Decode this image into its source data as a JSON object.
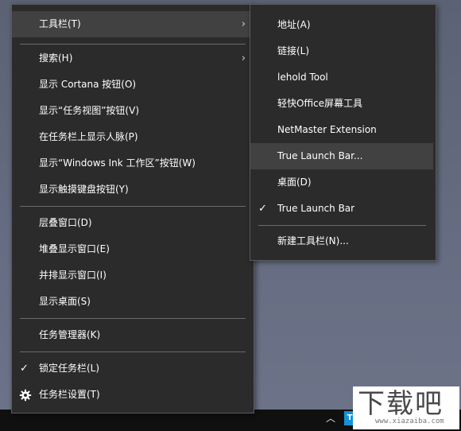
{
  "main_menu": {
    "toolbars": "工具栏(T)",
    "search": "搜索(H)",
    "show_cortana": "显示 Cortana 按钮(O)",
    "show_task_view": "显示“任务视图”按钮(V)",
    "show_people": "在任务栏上显示人脉(P)",
    "show_ink": "显示“Windows Ink 工作区”按钮(W)",
    "show_touch_keyboard": "显示触摸键盘按钮(Y)",
    "cascade": "层叠窗口(D)",
    "stacked": "堆叠显示窗口(E)",
    "side_by_side": "并排显示窗口(I)",
    "show_desktop": "显示桌面(S)",
    "task_manager": "任务管理器(K)",
    "lock_taskbar": "锁定任务栏(L)",
    "taskbar_settings": "任务栏设置(T)"
  },
  "sub_menu": {
    "address": "地址(A)",
    "links": "链接(L)",
    "lehold": "lehold Tool",
    "qingkuai": "轻快Office屏幕工具",
    "netmaster": "NetMaster Extension",
    "tlb_dots": "True Launch Bar...",
    "desktop": "桌面(D)",
    "tlb": "True Launch Bar",
    "new_toolbar": "新建工具栏(N)..."
  },
  "glyphs": {
    "arrow": "›",
    "check": "✓",
    "tray_up": "︿",
    "tray_icon": "T"
  },
  "watermark": {
    "text": "下载吧",
    "url": "www.xiazaiba.com"
  }
}
